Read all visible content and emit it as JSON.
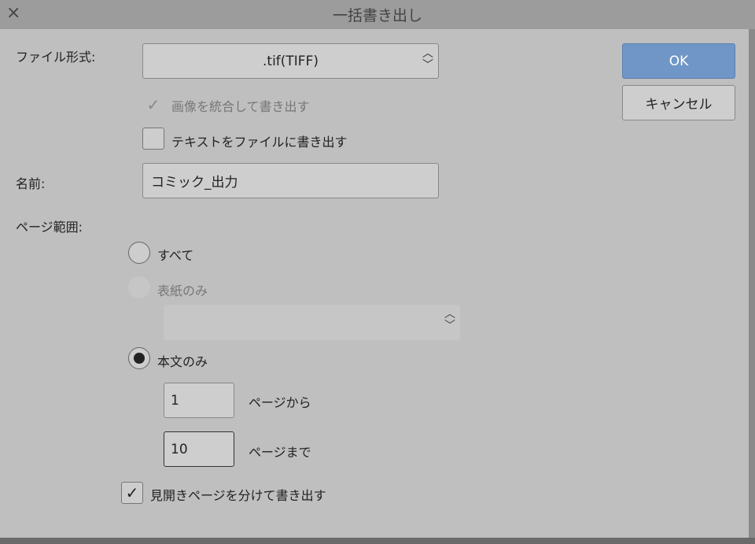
{
  "window": {
    "title": "一括書き出し",
    "close_icon": "×"
  },
  "form": {
    "file_format_label": "ファイル形式:",
    "file_format_value": ".tif(TIFF)",
    "merge_images_label": "画像を統合して書き出す",
    "export_text_label": "テキストをファイルに書き出す",
    "name_label": "名前:",
    "name_value": "コミック_出力",
    "page_range_label": "ページ範囲:",
    "radio_all": "すべて",
    "radio_cover": "表紙のみ",
    "radio_body": "本文のみ",
    "from_value": "1",
    "from_label": "ページから",
    "to_value": "10",
    "to_label": "ページまで",
    "split_spread_label": "見開きページを分けて書き出す"
  },
  "buttons": {
    "ok": "OK",
    "cancel": "キャンセル"
  },
  "colors": {
    "accent": "#6f96c6"
  }
}
